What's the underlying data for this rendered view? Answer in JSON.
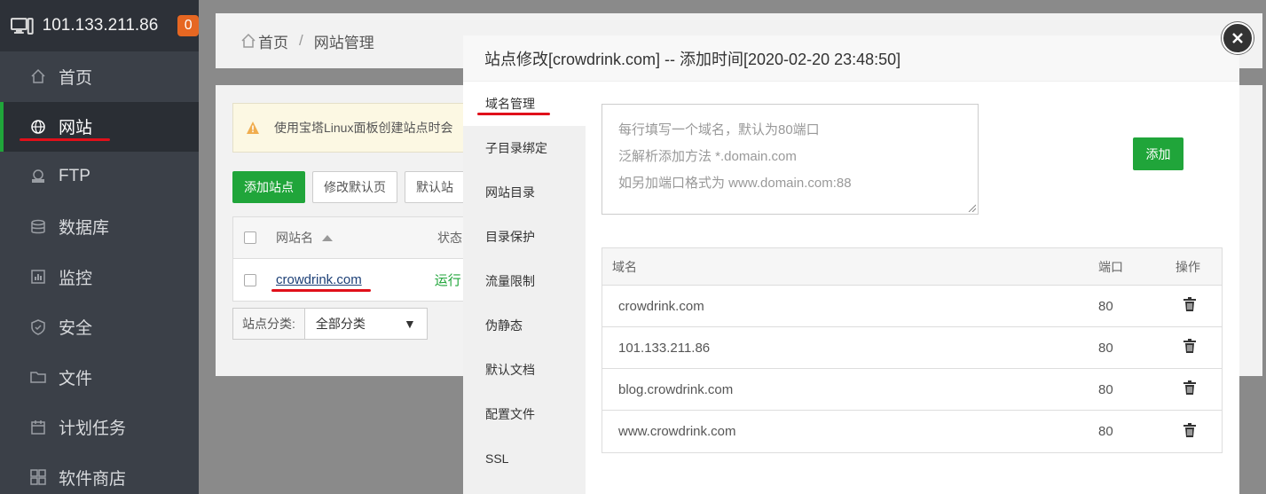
{
  "sidebar": {
    "server_ip": "101.133.211.86",
    "badge_count": "0",
    "items": [
      {
        "label": "首页",
        "icon": "home-icon"
      },
      {
        "label": "网站",
        "icon": "globe-icon",
        "active": true
      },
      {
        "label": "FTP",
        "icon": "ftp-icon"
      },
      {
        "label": "数据库",
        "icon": "database-icon"
      },
      {
        "label": "监控",
        "icon": "monitor-icon"
      },
      {
        "label": "安全",
        "icon": "shield-icon"
      },
      {
        "label": "文件",
        "icon": "folder-icon"
      },
      {
        "label": "计划任务",
        "icon": "calendar-icon"
      },
      {
        "label": "软件商店",
        "icon": "apps-icon"
      }
    ]
  },
  "breadcrumb": {
    "home": "首页",
    "separator": "/",
    "current": "网站管理"
  },
  "panel": {
    "notice": "使用宝塔Linux面板创建站点时会",
    "buttons": {
      "add_site": "添加站点",
      "edit_default_page": "修改默认页",
      "default_site": "默认站"
    },
    "table": {
      "col_name": "网站名",
      "col_status": "状态",
      "rows": [
        {
          "name": "crowdrink.com",
          "status": "运行"
        }
      ]
    },
    "category_label": "站点分类:",
    "category_value": "全部分类"
  },
  "modal": {
    "title": "站点修改[crowdrink.com] -- 添加时间[2020-02-20 23:48:50]",
    "tabs": [
      "域名管理",
      "子目录绑定",
      "网站目录",
      "目录保护",
      "流量限制",
      "伪静态",
      "默认文档",
      "配置文件",
      "SSL"
    ],
    "active_tab": "域名管理",
    "textarea_placeholder_lines": [
      "每行填写一个域名，默认为80端口",
      "泛解析添加方法 *.domain.com",
      "如另加端口格式为 www.domain.com:88"
    ],
    "add_button": "添加",
    "domain_table": {
      "col_domain": "域名",
      "col_port": "端口",
      "col_action": "操作",
      "rows": [
        {
          "domain": "crowdrink.com",
          "port": "80"
        },
        {
          "domain": "101.133.211.86",
          "port": "80"
        },
        {
          "domain": "blog.crowdrink.com",
          "port": "80"
        },
        {
          "domain": "www.crowdrink.com",
          "port": "80"
        }
      ]
    }
  },
  "colors": {
    "accent_green": "#20a53a",
    "annotation_red": "#e0101a",
    "sidebar_bg": "#3b4048",
    "badge_orange": "#e66722"
  }
}
